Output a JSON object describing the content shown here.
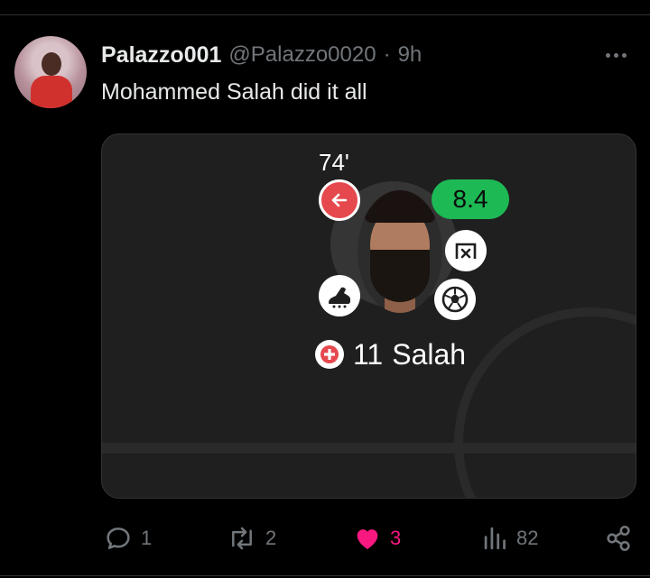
{
  "tweet": {
    "display_name": "Palazzo001",
    "handle": "@Palazzo0020",
    "separator": "·",
    "time": "9h",
    "text": "Mohammed Salah did it all"
  },
  "media": {
    "minute": "74'",
    "rating": "8.4",
    "player_number": "11",
    "player_name": "Salah",
    "icons": [
      "substitution-icon",
      "save-icon",
      "boot-icon",
      "ball-icon",
      "injury-icon"
    ]
  },
  "actions": {
    "replies": "1",
    "retweets": "2",
    "likes": "3",
    "views": "82"
  },
  "colors": {
    "background": "#000000",
    "rating_green": "#1db954",
    "sub_red": "#e5484d",
    "like_pink": "#f91880",
    "muted": "#71767b"
  }
}
